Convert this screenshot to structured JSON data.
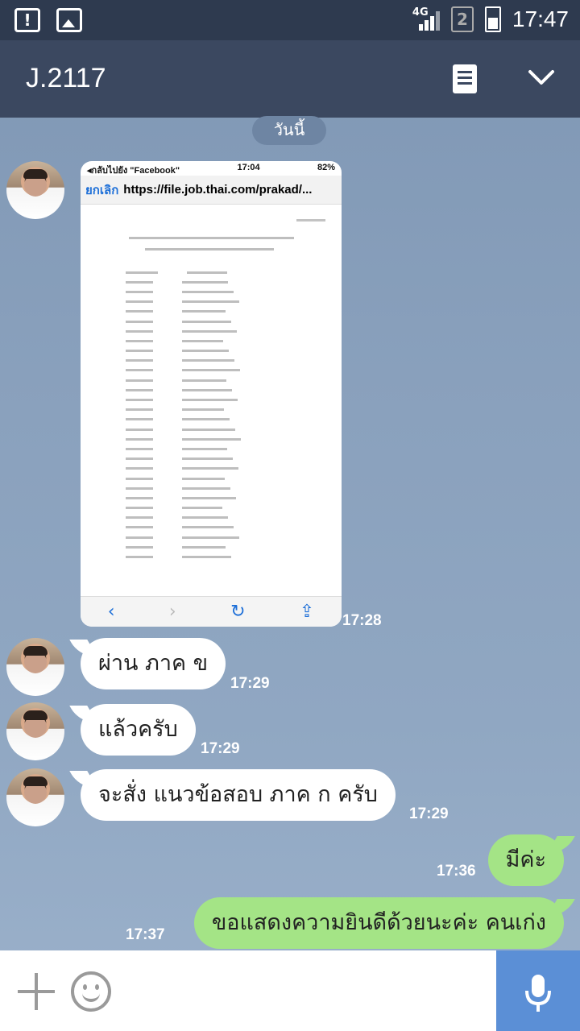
{
  "status_bar": {
    "network": "4G",
    "sim": "2",
    "time": "17:47"
  },
  "header": {
    "title": "J.2117"
  },
  "date_divider": "วันนี้",
  "image_message": {
    "shot_status_left": "◂กลับไปยัง \"Facebook\"",
    "shot_status_time": "17:04",
    "shot_status_battery": "82%",
    "shot_cancel": "ยกเลิก",
    "shot_url": "https://file.job.thai.com/prakad/...",
    "time": "17:28"
  },
  "messages": [
    {
      "text": "ผ่าน ภาค ข",
      "time": "17:29",
      "direction": "in"
    },
    {
      "text": "แล้วครับ",
      "time": "17:29",
      "direction": "in"
    },
    {
      "text": "จะสั่ง แนวข้อสอบ ภาค ก ครับ",
      "time": "17:29",
      "direction": "in"
    },
    {
      "text": "มีค่ะ",
      "time": "17:36",
      "direction": "out"
    },
    {
      "text": "ขอแสดงความยินดีด้วยนะค่ะ คนเก่ง",
      "time": "17:37",
      "direction": "out"
    }
  ],
  "colors": {
    "header_bg": "#3b4860",
    "status_bg": "#2e3a4f",
    "incoming_bubble": "#ffffff",
    "outgoing_bubble": "#a4e486",
    "mic_button_bg": "#5b8fd6"
  },
  "icons": {
    "notes": "notes-icon",
    "collapse": "chevron-down-icon",
    "add": "plus-icon",
    "emoji": "emoji-icon",
    "mic": "mic-icon"
  }
}
